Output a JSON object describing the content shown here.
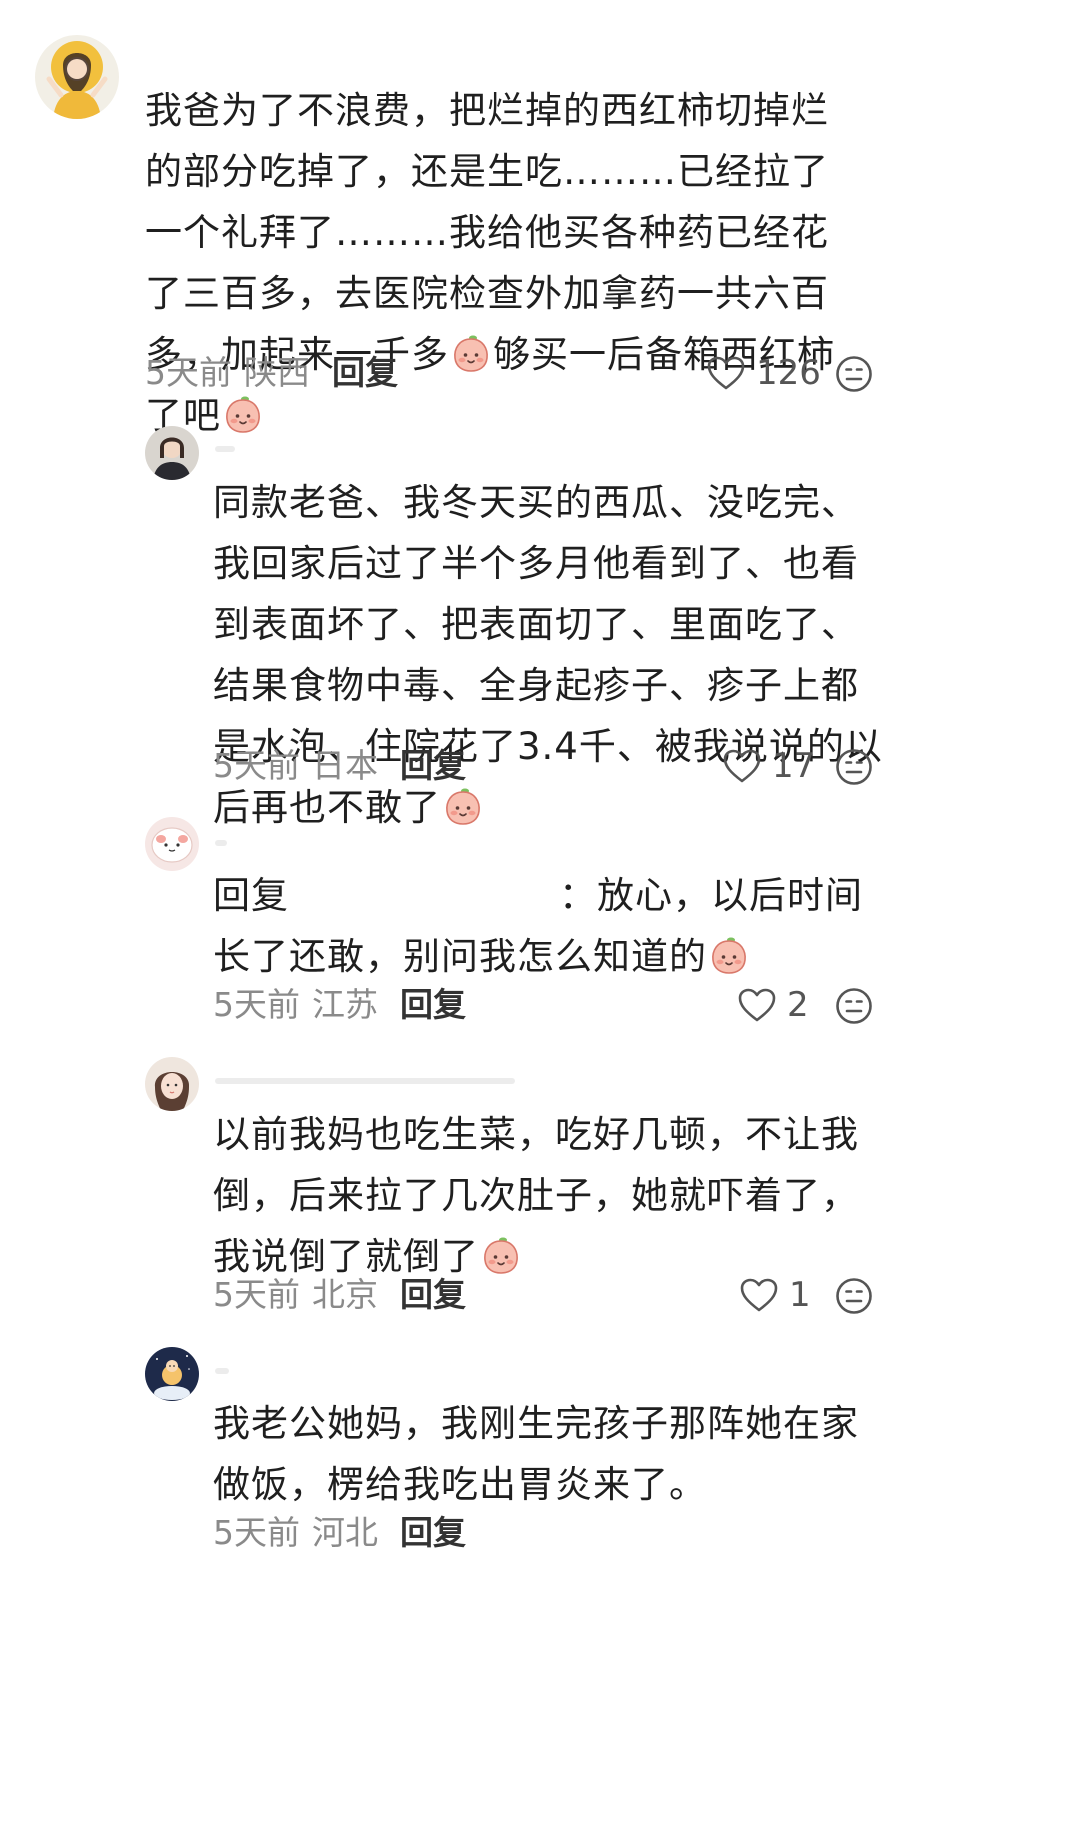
{
  "comments": [
    {
      "text_before": "我爸为了不浪费，把烂掉的西红柿切掉烂的部分吃掉了，还是生吃………已经拉了一个礼拜了………我给他买各种药已经花了三百多，去医院检查外加拿药一共六百多，加起来一千多",
      "text_after": "够买一后备箱西红柿了吧",
      "time": "5天前",
      "location": "陕西",
      "reply_label": "回复",
      "likes": "126"
    },
    {
      "text": "同款老爸、我冬天买的西瓜、没吃完、我回家后过了半个多月他看到了、也看到表面坏了、把表面切了、里面吃了、结果食物中毒、全身起疹子、疹子上都是水泡、住院花了3.4千、被我说说的以后再也不敢了",
      "time": "5天前",
      "location": "日本",
      "reply_label": "回复",
      "likes": "17"
    },
    {
      "reply_prefix": "回复",
      "colon": "：",
      "text": "放心，以后时间长了还敢，别问我怎么知道的",
      "time": "5天前",
      "location": "江苏",
      "reply_label": "回复",
      "likes": "2"
    },
    {
      "text": "以前我妈也吃生菜，吃好几顿，不让我倒，后来拉了几次肚子，她就吓着了，我说倒了就倒了",
      "time": "5天前",
      "location": "北京",
      "reply_label": "回复",
      "likes": "1"
    },
    {
      "text": "我老公她妈，我刚生完孩子那阵她在家做饭，楞给我吃出胃炎来了。",
      "time": "5天前",
      "location": "河北",
      "reply_label": "回复"
    }
  ],
  "icons": {
    "like": "heart-outline-icon",
    "dislike": "frown-face-icon",
    "emoji": "peach-emoji-icon"
  },
  "colors": {
    "meta_gray": "#8a8a8a",
    "text": "#1f1f1f",
    "emoji_pink": "#f7b4a8"
  }
}
